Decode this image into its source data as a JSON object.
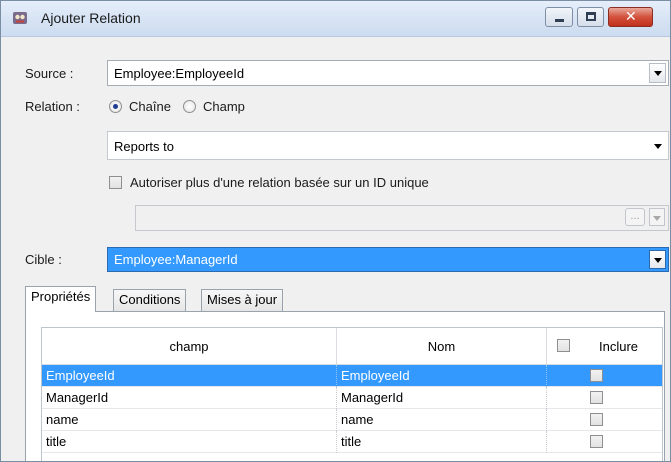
{
  "window": {
    "title": "Ajouter Relation",
    "controls": {
      "minimize": "minimize",
      "maximize": "maximize",
      "close": "x"
    }
  },
  "source": {
    "label": "Source :",
    "value": "Employee:EmployeeId"
  },
  "relation": {
    "label": "Relation :",
    "options": [
      {
        "label": "Chaîne",
        "checked": true
      },
      {
        "label": "Champ",
        "checked": false
      }
    ],
    "chain_value": "Reports to",
    "allow_multiple_label": "Autoriser plus d'une relation basée sur un ID unique",
    "allow_multiple_checked": false,
    "id_combo_value": "",
    "ellipsis_label": "..."
  },
  "target": {
    "label": "Cible :",
    "value": "Employee:ManagerId"
  },
  "tabs": [
    {
      "label": "Propriétés",
      "active": true
    },
    {
      "label": "Conditions",
      "active": false
    },
    {
      "label": "Mises à jour",
      "active": false
    }
  ],
  "grid": {
    "columns": {
      "field": "champ",
      "name": "Nom",
      "include": "Inclure"
    },
    "header_include_checked": false,
    "rows": [
      {
        "field": "EmployeeId",
        "name": "EmployeeId",
        "include": false,
        "selected": true
      },
      {
        "field": "ManagerId",
        "name": "ManagerId",
        "include": false,
        "selected": false
      },
      {
        "field": "name",
        "name": "name",
        "include": false,
        "selected": false
      },
      {
        "field": "title",
        "name": "title",
        "include": false,
        "selected": false
      }
    ]
  },
  "colors": {
    "selection": "#3399ff",
    "titlebar": "#d6e3f4",
    "close_button": "#c0301c"
  }
}
